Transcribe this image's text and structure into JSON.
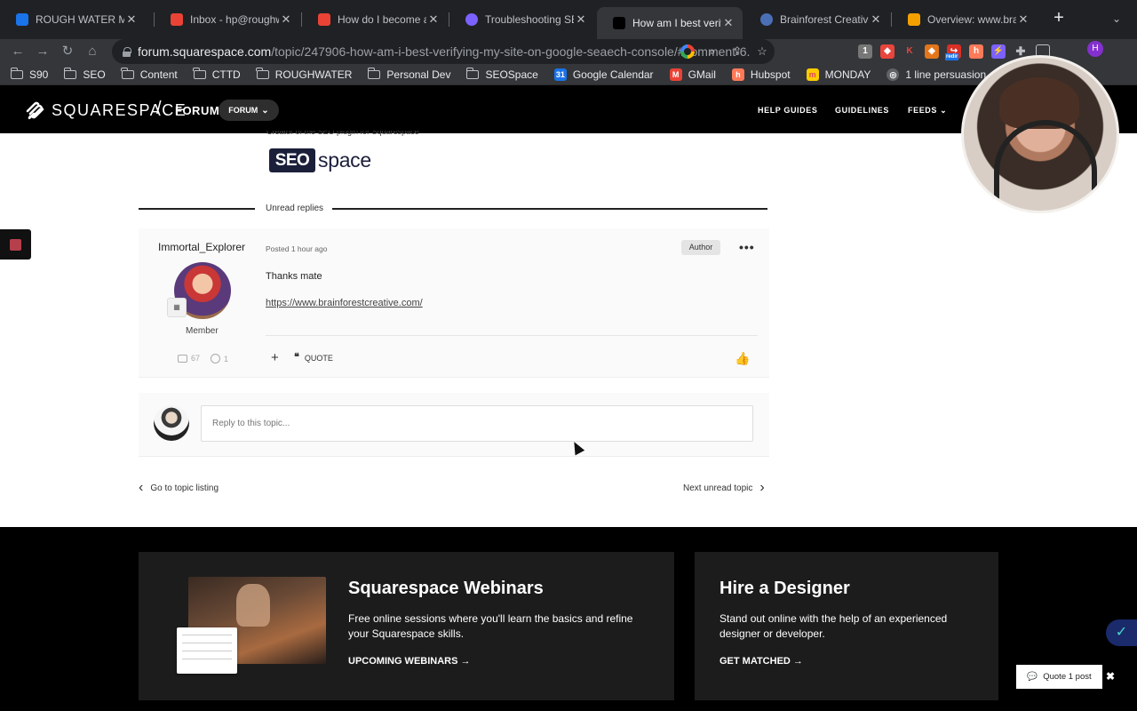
{
  "browser": {
    "tabs": [
      {
        "title": "ROUGH WATER MEDI",
        "favicon_color": "#1a73e8",
        "active": false
      },
      {
        "title": "Inbox - hp@roughwat",
        "favicon_color": "#ea4335",
        "active": false
      },
      {
        "title": "How do I become an",
        "favicon_color": "#ea4335",
        "active": false
      },
      {
        "title": "Troubleshooting SEO",
        "favicon_color": "#7b61ff",
        "active": false
      },
      {
        "title": "How am I best verifyi",
        "favicon_color": "#000000",
        "active": true
      },
      {
        "title": "Brainforest Creative",
        "favicon_color": "#4a6fb5",
        "active": false
      },
      {
        "title": "Overview: www.brain",
        "favicon_color": "#f4a100",
        "active": false
      }
    ],
    "url_host": "forum.squarespace.com",
    "url_path": "/topic/247906-how-am-i-best-verifying-my-site-on-google-seaech-console/#comment-6...",
    "ext_redir_label": "redir",
    "profile_initial": "H",
    "bookmarks": [
      {
        "label": "S90",
        "type": "folder"
      },
      {
        "label": "SEO",
        "type": "folder"
      },
      {
        "label": "Content",
        "type": "folder"
      },
      {
        "label": "CTTD",
        "type": "folder"
      },
      {
        "label": "ROUGHWATER",
        "type": "folder"
      },
      {
        "label": "Personal Dev",
        "type": "folder"
      },
      {
        "label": "SEOSpace",
        "type": "folder"
      },
      {
        "label": "Google Calendar",
        "type": "calendar",
        "color": "#1a73e8"
      },
      {
        "label": "GMail",
        "type": "gmail",
        "color": "#ea4335"
      },
      {
        "label": "Hubspot",
        "type": "hubspot",
        "color": "#ff7a59"
      },
      {
        "label": "MONDAY",
        "type": "monday",
        "color": "#ffcb00"
      },
      {
        "label": "1 line persuasion",
        "type": "globe",
        "color": "#bdc1c6"
      }
    ]
  },
  "site": {
    "brand": "SQUARESPACE",
    "section": "FORUM",
    "forum_dropdown": "FORUM",
    "nav": [
      "HELP GUIDES",
      "GUIDELINES",
      "FEEDS"
    ]
  },
  "previous_post": {
    "creator_line": "Creator of the SEO plugin for Squarespace",
    "logo_seo": "SEO",
    "logo_space": "space"
  },
  "divider_label": "Unread replies",
  "post": {
    "author": "Immortal_Explorer",
    "role": "Member",
    "posts_count": "67",
    "solutions_count": "1",
    "posted": "Posted 1 hour ago",
    "badge": "Author",
    "body": "Thanks mate",
    "link": "https://www.brainforestcreative.com/",
    "quote_label": "QUOTE"
  },
  "reply": {
    "placeholder": "Reply to this topic..."
  },
  "pager": {
    "prev": "Go to topic listing",
    "next": "Next unread topic"
  },
  "footer": {
    "webinars": {
      "title": "Squarespace Webinars",
      "text": "Free online sessions where you'll learn the basics and refine your Squarespace skills.",
      "cta": "UPCOMING WEBINARS →"
    },
    "designer": {
      "title": "Hire a Designer",
      "text": "Stand out online with the help of an experienced designer or developer.",
      "cta": "GET MATCHED →"
    }
  },
  "quote_bar": {
    "label": "Quote 1 post"
  }
}
